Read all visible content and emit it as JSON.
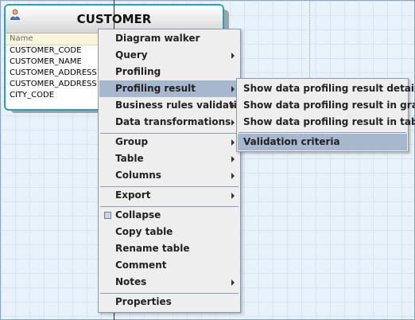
{
  "entity": {
    "title": "CUSTOMER",
    "column_header": "Name",
    "columns": [
      "CUSTOMER_CODE",
      "CUSTOMER_NAME",
      "CUSTOMER_ADDRESS",
      "CUSTOMER_ADDRESS",
      "CITY_CODE"
    ]
  },
  "menu": {
    "items": [
      {
        "label": "Diagram walker",
        "has_submenu": false
      },
      {
        "label": "Query",
        "has_submenu": true
      },
      {
        "label": "Profiling",
        "has_submenu": false
      },
      {
        "label": "Profiling result",
        "has_submenu": true,
        "highlighted": true
      },
      {
        "label": "Business rules validation",
        "has_submenu": true
      },
      {
        "label": "Data transformations",
        "has_submenu": true
      },
      {
        "label": "Group",
        "has_submenu": true
      },
      {
        "label": "Table",
        "has_submenu": true
      },
      {
        "label": "Columns",
        "has_submenu": true
      },
      {
        "label": "Export",
        "has_submenu": true
      },
      {
        "label": "Collapse",
        "has_submenu": false,
        "checkbox": true
      },
      {
        "label": "Copy table",
        "has_submenu": false
      },
      {
        "label": "Rename table",
        "has_submenu": false
      },
      {
        "label": "Comment",
        "has_submenu": false
      },
      {
        "label": "Notes",
        "has_submenu": true
      },
      {
        "label": "Properties",
        "has_submenu": false
      }
    ]
  },
  "submenu": {
    "items": [
      {
        "label": "Show data profiling result details"
      },
      {
        "label": "Show data profiling result in graph"
      },
      {
        "label": "Show data profiling result in table"
      },
      {
        "label": "Validation criteria",
        "highlighted": true
      }
    ]
  },
  "colors": {
    "highlight": "#a6b7ce",
    "entity_border": "#27a2b0",
    "canvas_bg": "#e8f2fa"
  }
}
